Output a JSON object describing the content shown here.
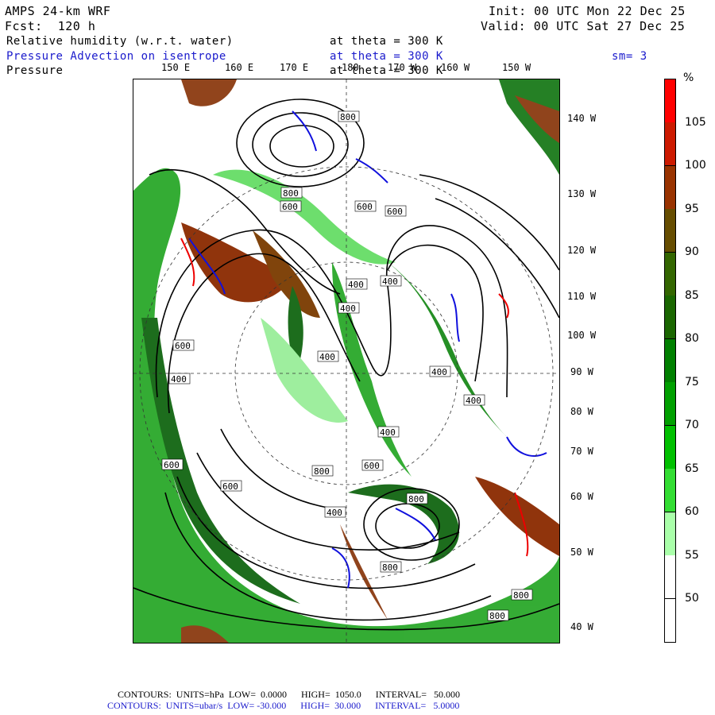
{
  "header": {
    "model": "AMPS 24-km WRF",
    "init": "Init: 00 UTC Mon 22 Dec 25",
    "fcst": "Fcst:  120 h",
    "valid": "Valid: 00 UTC Sat 27 Dec 25",
    "field1_name": "Relative humidity (w.r.t. water)",
    "field1_level": "at theta = 300 K",
    "field2_name": "Pressure Advection on isentrope",
    "field2_level": "at theta = 300 K",
    "smoothing": "sm= 3",
    "field3_name": "Pressure",
    "field3_level": "at theta = 300 K"
  },
  "map": {
    "top_longitudes": [
      "150 E",
      "160 E",
      "170 E",
      "180",
      "170 W",
      "160 W",
      "150 W"
    ],
    "right_longitudes": [
      "140 W",
      "130 W",
      "120 W",
      "110 W",
      "100 W",
      "90 W",
      "80 W",
      "70 W",
      "60 W",
      "50 W",
      "40 W"
    ],
    "contour_labels": [
      "800",
      "600",
      "600",
      "800",
      "400",
      "400",
      "400",
      "400",
      "400",
      "400",
      "400",
      "400",
      "400",
      "600",
      "600",
      "600",
      "800",
      "800",
      "600",
      "800",
      "600",
      "800",
      "800"
    ]
  },
  "colorbar": {
    "unit": "%",
    "labels": [
      "105",
      "100",
      "95",
      "90",
      "85",
      "80",
      "75",
      "70",
      "65",
      "60",
      "55",
      "50"
    ],
    "colors": [
      "#ff0000",
      "#cc1a00",
      "#993300",
      "#664d00",
      "#336600",
      "#1a6600",
      "#008000",
      "#00a000",
      "#00c000",
      "#33dd33",
      "#aaffaa",
      "#ffffff",
      "#ffffff"
    ]
  },
  "footer": {
    "line1": "CONTOURS:  UNITS=hPa  LOW=  0.0000      HIGH=  1050.0      INTERVAL=   50.000",
    "line2": "CONTOURS:  UNITS=ubar/s  LOW= -30.000      HIGH=  30.000      INTERVAL=   5.0000"
  }
}
